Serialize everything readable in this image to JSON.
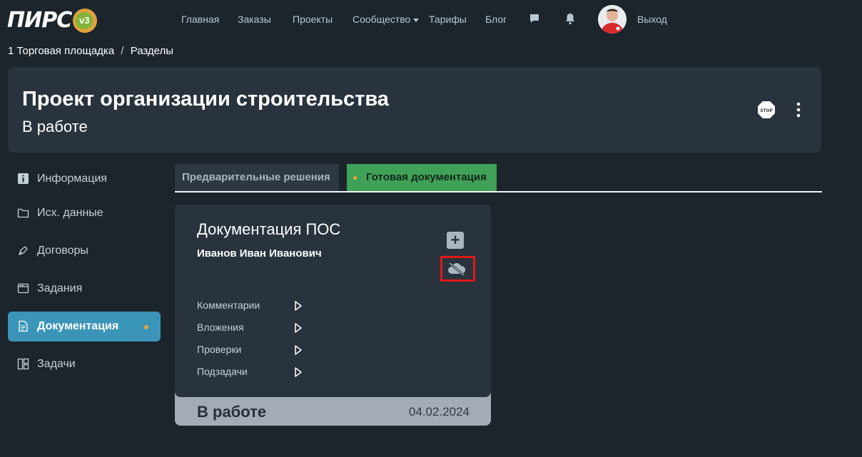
{
  "logo": {
    "text": "ПИРС",
    "version": "v3"
  },
  "nav": {
    "home": "Главная",
    "orders": "Заказы",
    "projects": "Проекты",
    "community": "Сообщество",
    "tariffs": "Тарифы",
    "blog": "Блог",
    "logout": "Выход"
  },
  "breadcrumb": {
    "first": "1 Торговая площадка",
    "separator": "/",
    "second": "Разделы"
  },
  "project": {
    "title": "Проект организации строительства",
    "status": "В работе"
  },
  "sidebar": {
    "items": [
      {
        "label": "Информация",
        "icon": "info-icon"
      },
      {
        "label": "Исх. данные",
        "icon": "folder-icon"
      },
      {
        "label": "Договоры",
        "icon": "pen-icon"
      },
      {
        "label": "Задания",
        "icon": "window-icon"
      },
      {
        "label": "Документация",
        "icon": "document-icon",
        "active": true
      },
      {
        "label": "Задачи",
        "icon": "layout-icon"
      }
    ]
  },
  "tabs": [
    {
      "label": "Предварительные решения"
    },
    {
      "label": "Готовая документация",
      "active": true
    }
  ],
  "doc": {
    "title": "Документация ПОС",
    "author": "Иванов Иван Иванович",
    "sections": [
      "Комментарии",
      "Вложения",
      "Проверки",
      "Подзадачи"
    ],
    "state": "В работе",
    "date": "04.02.2024"
  },
  "colors": {
    "background": "#1c252c",
    "card": "#29333d",
    "active_sidebar": "#3b95b8",
    "active_tab": "#3fa158",
    "accent_dot": "#e8a53a",
    "highlight": "#e01818"
  }
}
